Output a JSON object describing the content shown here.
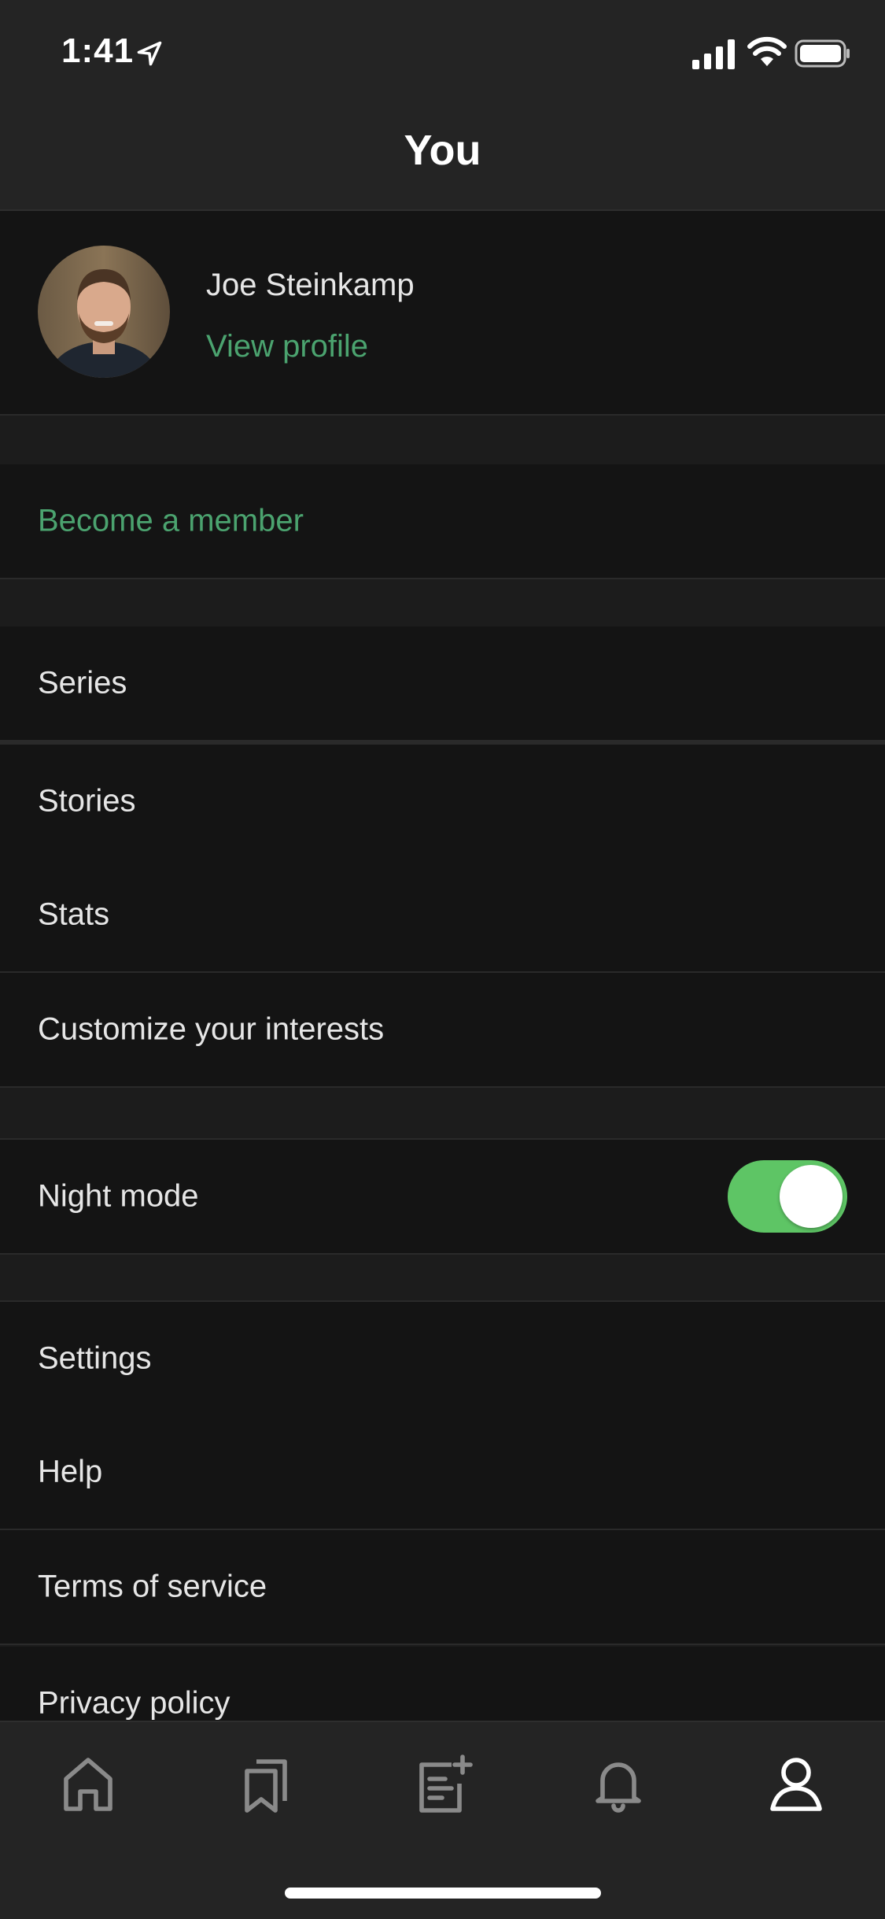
{
  "status_bar": {
    "time": "1:41"
  },
  "header": {
    "title": "You"
  },
  "profile": {
    "name": "Joe Steinkamp",
    "link": "View profile"
  },
  "membership": {
    "label": "Become a member"
  },
  "menu_group_1": {
    "series": "Series",
    "stories": "Stories",
    "stats": "Stats",
    "interests": "Customize your interests"
  },
  "night_mode": {
    "label": "Night mode",
    "enabled": true
  },
  "menu_group_2": {
    "settings": "Settings",
    "help": "Help",
    "terms": "Terms of service",
    "privacy": "Privacy policy"
  },
  "tab_bar": {
    "items": [
      "home-icon",
      "bookmarks-icon",
      "new-story-icon",
      "notifications-icon",
      "profile-icon"
    ],
    "active": "profile-icon"
  },
  "colors": {
    "accent": "#4ba36f",
    "toggle_on": "#5ec565",
    "background": "#141414"
  }
}
